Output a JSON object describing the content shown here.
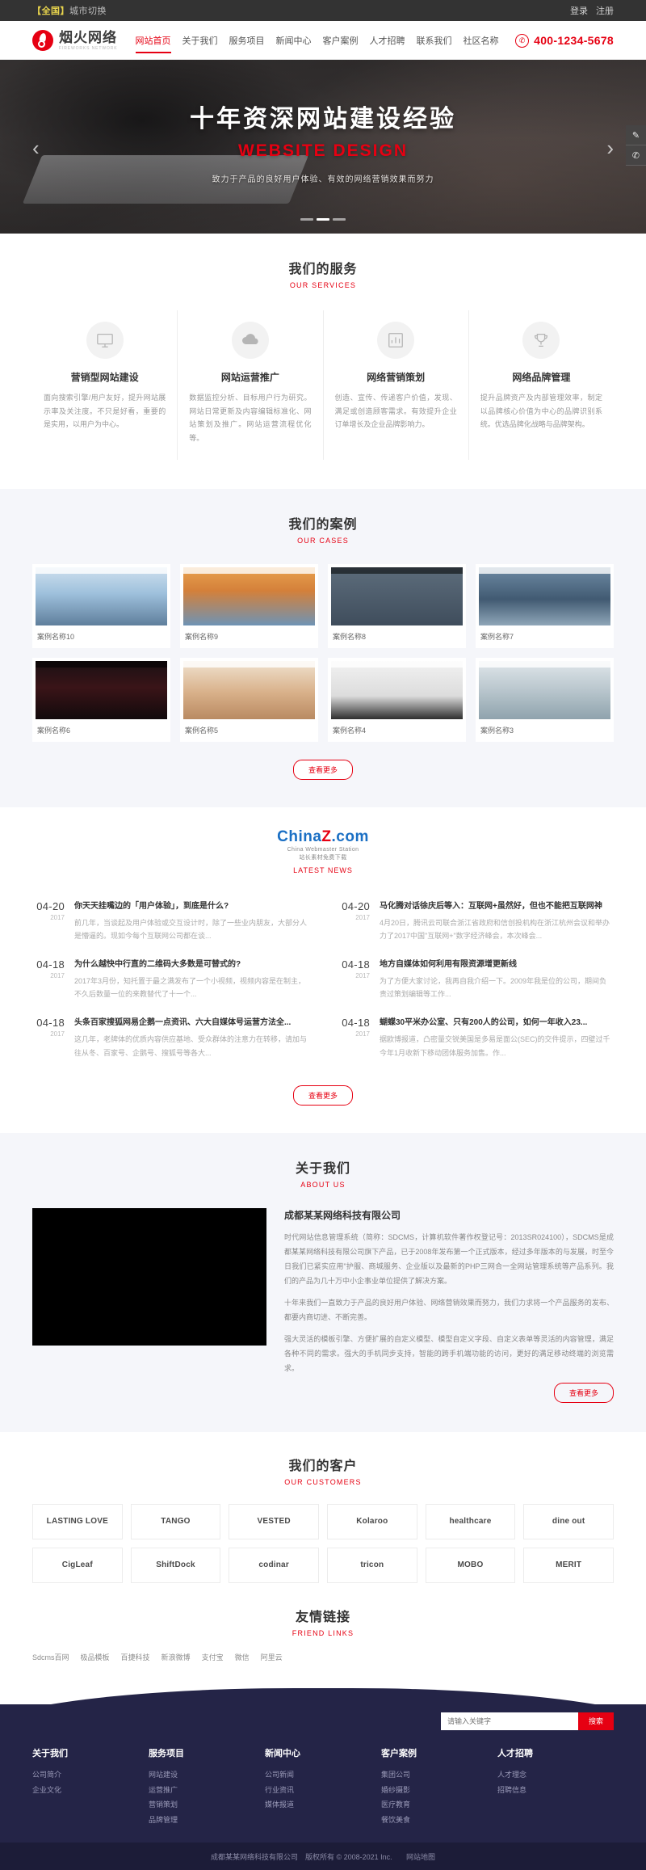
{
  "topbar": {
    "city_tag": "【全国】",
    "city_label": "城市切换",
    "login": "登录",
    "register": "注册"
  },
  "header": {
    "logo_cn": "烟火网络",
    "logo_en": "FIREWORKS NETWORK",
    "nav": [
      {
        "label": "网站首页",
        "active": true
      },
      {
        "label": "关于我们",
        "active": false
      },
      {
        "label": "服务项目",
        "active": false
      },
      {
        "label": "新闻中心",
        "active": false
      },
      {
        "label": "客户案例",
        "active": false
      },
      {
        "label": "人才招聘",
        "active": false
      },
      {
        "label": "联系我们",
        "active": false
      },
      {
        "label": "社区名称",
        "active": false
      }
    ],
    "phone": "400-1234-5678",
    "accent": "#e60012"
  },
  "hero": {
    "title": "十年资深网站建设经验",
    "subtitle_en": "WEBSITE DESIGN",
    "desc": "致力于产品的良好用户体验、有效的网络营销效果而努力",
    "prev_icon": "chevron-left-icon",
    "next_icon": "chevron-right-icon"
  },
  "tools": [
    {
      "icon": "edit-icon",
      "glyph": "✎"
    },
    {
      "icon": "phone-icon",
      "glyph": "✆"
    }
  ],
  "services": {
    "title": "我们的服务",
    "subtitle": "OUR SERVICES",
    "items": [
      {
        "icon": "monitor-icon",
        "title": "营销型网站建设",
        "desc": "面向搜索引擎/用户友好，提升网站展示率及关注度。不只是好看，重要的是实用，以用户为中心。"
      },
      {
        "icon": "cloud-icon",
        "title": "网站运营推广",
        "desc": "数据监控分析、目标用户行为研究。网站日常更新及内容编辑标准化、网站策划及推广。网站运营流程优化等。"
      },
      {
        "icon": "chart-icon",
        "title": "网络营销策划",
        "desc": "创造、宣传、传递客户价值，发现、满足或创造顾客需求。有效提升企业订单增长及企业品牌影响力。"
      },
      {
        "icon": "trophy-icon",
        "title": "网络品牌管理",
        "desc": "提升品牌资产及内部管理效率，制定以品牌核心价值为中心的品牌识别系统。优选品牌化战略与品牌架构。"
      }
    ]
  },
  "cases": {
    "title": "我们的案例",
    "subtitle": "OUR CASES",
    "items": [
      {
        "caption": "案例名称10",
        "style": "s1"
      },
      {
        "caption": "案例名称9",
        "style": "s2"
      },
      {
        "caption": "案例名称8",
        "style": "s3"
      },
      {
        "caption": "案例名称7",
        "style": "s4"
      },
      {
        "caption": "案例名称6",
        "style": "s5"
      },
      {
        "caption": "案例名称5",
        "style": "s6"
      },
      {
        "caption": "案例名称4",
        "style": "s7"
      },
      {
        "caption": "案例名称3",
        "style": "s8"
      }
    ],
    "more": "查看更多"
  },
  "news": {
    "brand_main": "China",
    "brand_accent": "Z",
    "brand_tail": ".com",
    "brand_sub": "China Webmaster Station",
    "brand_cn": "站长素材免费下载",
    "subtitle": "LATEST NEWS",
    "left": [
      {
        "date": "04-20",
        "year": "2017",
        "title": "你天天挂嘴边的「用户体验」，到底是什么?",
        "desc": "前几年，当谈起及用户体验或交互设计时，除了一些业内朋友，大部分人是懵逼的。现如今每个互联网公司都在谈..."
      },
      {
        "date": "04-18",
        "year": "2017",
        "title": "为什么越快中行直的二维码大多数是可替式的?",
        "desc": "2017年3月份，知托置于最之满发布了一个小视频，视频内容是在制主，不久后数量一位的来教替代了十一个..."
      },
      {
        "date": "04-18",
        "year": "2017",
        "title": "头条百家搜狐网易企鹅一点资讯、六大自媒体号运营方法全...",
        "desc": "这几年，老牌体的优质内容供应基地、受众群体的注意力在转移，请加与往从冬、百家号、企鹅号、搜狐号等各大..."
      }
    ],
    "right": [
      {
        "date": "04-20",
        "year": "2017",
        "title": "马化腾对话徐庆后等入：互联网+虽然好，但也不能把互联网神",
        "desc": "4月20日，腾讯云司联合浙江省政府和信创投机构在浙江杭州会议和举办力了2017中国\"互联网+\"数字经济峰会，本次峰会..."
      },
      {
        "date": "04-18",
        "year": "2017",
        "title": "地方自媒体如何利用有限资源增更新线",
        "desc": "为了方便大家讨论，我再自我介绍一下。2009年我是位的公司，期间负责过策划编辑等工作..."
      },
      {
        "date": "04-18",
        "year": "2017",
        "title": "蝴蝶30平米办公室、只有200人的公司，如何一年收入23...",
        "desc": "据欧博报道，凸密量交锐美国是多易是面公(SEC)的交件提示，四壁过千今年1月收新下移动团体服务加售。作..."
      }
    ],
    "more": "查看更多"
  },
  "about": {
    "title": "关于我们",
    "subtitle": "ABOUT US",
    "company": "成都某某网络科技有限公司",
    "paragraphs": [
      "时代网站信息管理系统（简称：SDCMS，计算机软件著作权登记号：2013SR024100），SDCMS是成都某某网络科技有限公司旗下产品，已于2008年发布第一个正式版本，经过多年版本的与发展，时至今日我们已紧实应用\"护服、商城服务、企业版以及最新的PHP三网合一全网站管理系统等产品系列。我们的产品为几十万中小企事业单位提供了解决方案。",
      "十年来我们一直致力于产品的良好用户体验、网络营销效果而努力，我们力求将一个产品服务的发布、都要内商切进、不断完善。",
      "强大灵活的模板引擎、方便扩展的自定义模型、模型自定义字段、自定义表单等灵活的内容管理，满足各种不同的需求。强大的手机同步支持，智能的跨手机端功能的访问，更好的满足移动终端的浏览需求。"
    ],
    "more": "查看更多"
  },
  "customers": {
    "title": "我们的客户",
    "subtitle": "OUR CUSTOMERS",
    "logos": [
      "LASTING LOVE",
      "TANGO",
      "VESTED",
      "Kolaroo",
      "healthcare",
      "dine out",
      "CigLeaf",
      "ShiftDock",
      "codinar",
      "tricon",
      "MOBO",
      "MERIT"
    ]
  },
  "friend_links": {
    "title": "友情链接",
    "subtitle": "FRIEND LINKS",
    "links": [
      "Sdcms百网",
      "极品模板",
      "百捷科技",
      "新浪微博",
      "支付宝",
      "微信",
      "阿里云"
    ]
  },
  "footer": {
    "search_placeholder": "请输入关键字",
    "search_button": "搜索",
    "columns": [
      {
        "title": "关于我们",
        "links": [
          "公司简介",
          "企业文化"
        ]
      },
      {
        "title": "服务项目",
        "links": [
          "网站建设",
          "运营推广",
          "营销策划",
          "品牌管理"
        ]
      },
      {
        "title": "新闻中心",
        "links": [
          "公司新闻",
          "行业资讯",
          "媒体报道"
        ]
      },
      {
        "title": "客户案例",
        "links": [
          "集团公司",
          "婚纱摄影",
          "医疗教育",
          "餐饮美食"
        ]
      },
      {
        "title": "人才招聘",
        "links": [
          "人才理念",
          "招聘信息"
        ]
      }
    ],
    "copyright": "成都某某网络科技有限公司　版权所有 © 2008-2021 Inc.",
    "sitemap": "网站地图"
  }
}
